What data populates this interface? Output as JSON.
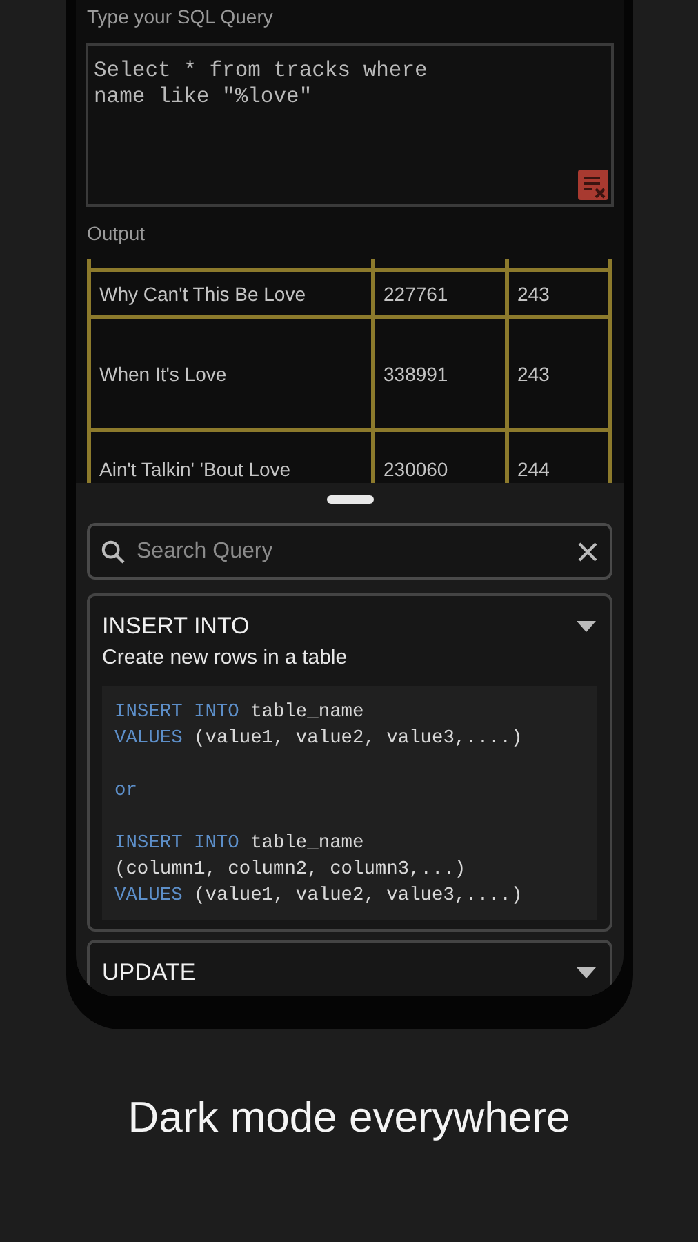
{
  "query_label": "Type your SQL Query",
  "query": {
    "value": "Select * from tracks where\nname like \"%love\""
  },
  "output_label": "Output",
  "table": {
    "rows": [
      {
        "cells": [
          "Why Can't This Be Love",
          "227761",
          "243"
        ]
      },
      {
        "cells": [
          "When It's Love",
          "338991",
          "243"
        ]
      },
      {
        "cells": [
          "Ain't Talkin' 'Bout Love",
          "230060",
          "244"
        ]
      }
    ]
  },
  "sheet": {
    "search": {
      "placeholder": "Search Query"
    },
    "cards": [
      {
        "title": "INSERT INTO",
        "subtitle": "Create new rows in a table",
        "code": [
          {
            "lines": [
              {
                "tokens": [
                  {
                    "kind": "keyword",
                    "text": "INSERT INTO"
                  },
                  {
                    "kind": "plain",
                    "text": " table_name"
                  }
                ]
              },
              {
                "tokens": [
                  {
                    "kind": "keyword",
                    "text": "VALUES"
                  },
                  {
                    "kind": "plain",
                    "text": " (value1, value2, value3,....)"
                  }
                ]
              }
            ]
          },
          {
            "lines": [
              {
                "tokens": [
                  {
                    "kind": "keyword",
                    "text": "or"
                  }
                ]
              }
            ]
          },
          {
            "lines": [
              {
                "tokens": [
                  {
                    "kind": "keyword",
                    "text": "INSERT INTO"
                  },
                  {
                    "kind": "plain",
                    "text": " table_name"
                  }
                ]
              },
              {
                "tokens": [
                  {
                    "kind": "plain",
                    "text": "(column1, column2, column3,...)"
                  }
                ]
              },
              {
                "tokens": [
                  {
                    "kind": "keyword",
                    "text": "VALUES"
                  },
                  {
                    "kind": "plain",
                    "text": " (value1, value2, value3,....)"
                  }
                ]
              }
            ]
          }
        ]
      },
      {
        "title": "UPDATE"
      }
    ]
  },
  "caption": "Dark mode everywhere"
}
